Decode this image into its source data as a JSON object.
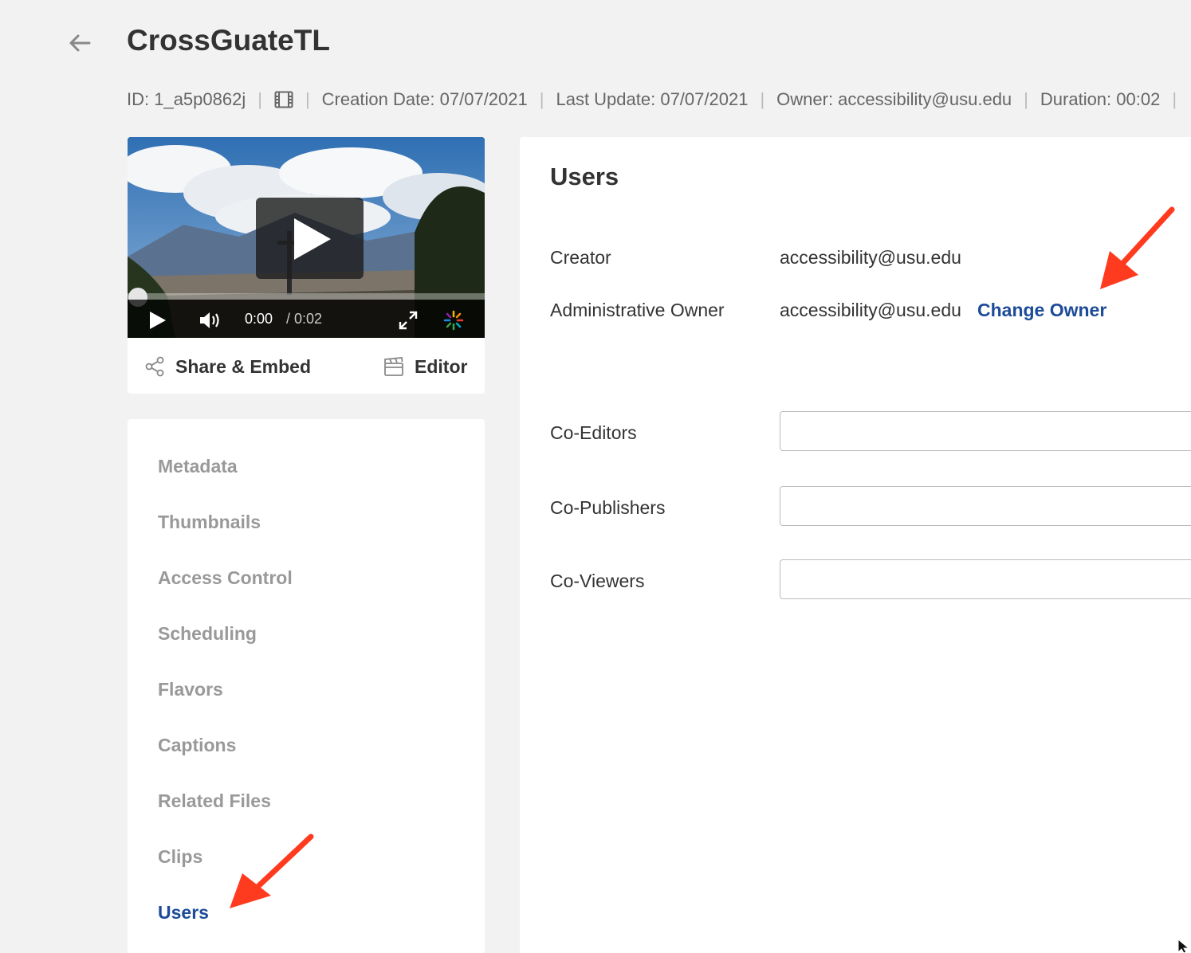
{
  "header": {
    "title": "CrossGuateTL",
    "meta": {
      "id": "ID: 1_a5p0862j",
      "media_type_icon": "film-icon",
      "creation_date": "Creation Date: 07/07/2021",
      "last_update": "Last Update: 07/07/2021",
      "owner": "Owner: accessibility@usu.edu",
      "duration": "Duration: 00:02"
    }
  },
  "player": {
    "current_time": "0:00",
    "duration": "/ 0:02",
    "progress": 0,
    "share_label": "Share & Embed",
    "editor_label": "Editor"
  },
  "nav": {
    "items": [
      {
        "label": "Metadata",
        "active": false
      },
      {
        "label": "Thumbnails",
        "active": false
      },
      {
        "label": "Access Control",
        "active": false
      },
      {
        "label": "Scheduling",
        "active": false
      },
      {
        "label": "Flavors",
        "active": false
      },
      {
        "label": "Captions",
        "active": false
      },
      {
        "label": "Related Files",
        "active": false
      },
      {
        "label": "Clips",
        "active": false
      },
      {
        "label": "Users",
        "active": true
      }
    ]
  },
  "users": {
    "title": "Users",
    "creator_label": "Creator",
    "creator_value": "accessibility@usu.edu",
    "admin_owner_label": "Administrative Owner",
    "admin_owner_value": "accessibility@usu.edu",
    "change_owner_label": "Change Owner",
    "co_editors_label": "Co-Editors",
    "co_editors_value": "",
    "co_publishers_label": "Co-Publishers",
    "co_publishers_value": "",
    "co_viewers_label": "Co-Viewers",
    "co_viewers_value": ""
  },
  "colors": {
    "accent": "#1c4b99",
    "annotation_arrow": "#ff3b1f",
    "background": "#f2f2f2"
  }
}
